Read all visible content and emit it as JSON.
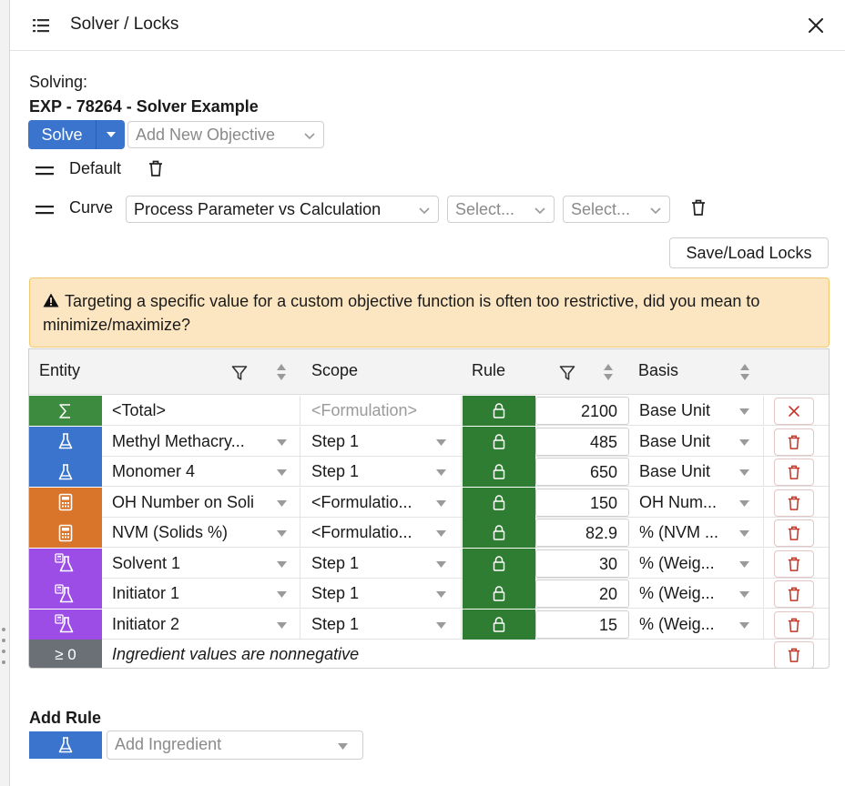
{
  "header": {
    "title": "Solver / Locks",
    "menu_icon": "list-icon",
    "close_icon": "close-icon"
  },
  "solving": {
    "label": "Solving:",
    "experiment": "EXP - 78264 - Solver Example"
  },
  "toolbar": {
    "solve_label": "Solve",
    "objective_placeholder": "Add New Objective"
  },
  "objectives": [
    {
      "name": "Default"
    },
    {
      "name": "Curve",
      "curve_type": "Process Parameter vs Calculation",
      "x_placeholder": "Select...",
      "y_placeholder": "Select..."
    }
  ],
  "save_load_label": "Save/Load Locks",
  "warning": {
    "text": "Targeting a specific value for a custom objective function is often too restrictive, did you mean to minimize/maximize?"
  },
  "table": {
    "columns": {
      "entity": "Entity",
      "scope": "Scope",
      "rule": "Rule",
      "basis": "Basis"
    },
    "rows": [
      {
        "icon": "sigma-icon",
        "color": "#3c8b3f",
        "name": "<Total>",
        "scope": "<Formulation>",
        "scope_placeholder": true,
        "value": "2100",
        "basis": "Base Unit",
        "action": "close-icon"
      },
      {
        "icon": "flask-icon",
        "color": "#3b74cc",
        "name": "Methyl Methacry...",
        "scope": "Step 1",
        "value": "485",
        "basis": "Base Unit",
        "action": "trash-icon"
      },
      {
        "icon": "flask-icon",
        "color": "#3b74cc",
        "name": "Monomer 4",
        "scope": "Step 1",
        "value": "650",
        "basis": "Base Unit",
        "action": "trash-icon"
      },
      {
        "icon": "calculator-icon",
        "color": "#d9742b",
        "name": "OH Number on Soli",
        "scope": "<Formulatio...",
        "value": "150",
        "basis": "OH Num...",
        "action": "trash-icon"
      },
      {
        "icon": "calculator-icon",
        "color": "#d9742b",
        "name": "NVM (Solids %)",
        "scope": "<Formulatio...",
        "value": "82.9",
        "basis": "% (NVM ...",
        "action": "trash-icon"
      },
      {
        "icon": "flask-calc-icon",
        "color": "#9b4de6",
        "name": "Solvent 1",
        "scope": "Step 1",
        "value": "30",
        "basis": "% (Weig...",
        "action": "trash-icon"
      },
      {
        "icon": "flask-calc-icon",
        "color": "#9b4de6",
        "name": "Initiator 1",
        "scope": "Step 1",
        "value": "20",
        "basis": "% (Weig...",
        "action": "trash-icon"
      },
      {
        "icon": "flask-calc-icon",
        "color": "#9b4de6",
        "name": "Initiator 2",
        "scope": "Step 1",
        "value": "15",
        "basis": "% (Weig...",
        "action": "trash-icon"
      }
    ],
    "constraint": {
      "badge": "≥ 0",
      "color": "#6b6f76",
      "text": "Ingredient values are nonnegative"
    }
  },
  "add_rule": {
    "label": "Add Rule",
    "placeholder": "Add Ingredient"
  },
  "colors": {
    "accent": "#3b74cc",
    "lock_green": "#2f7d32",
    "warning_bg": "#fce6c2",
    "danger": "#c0392b"
  }
}
